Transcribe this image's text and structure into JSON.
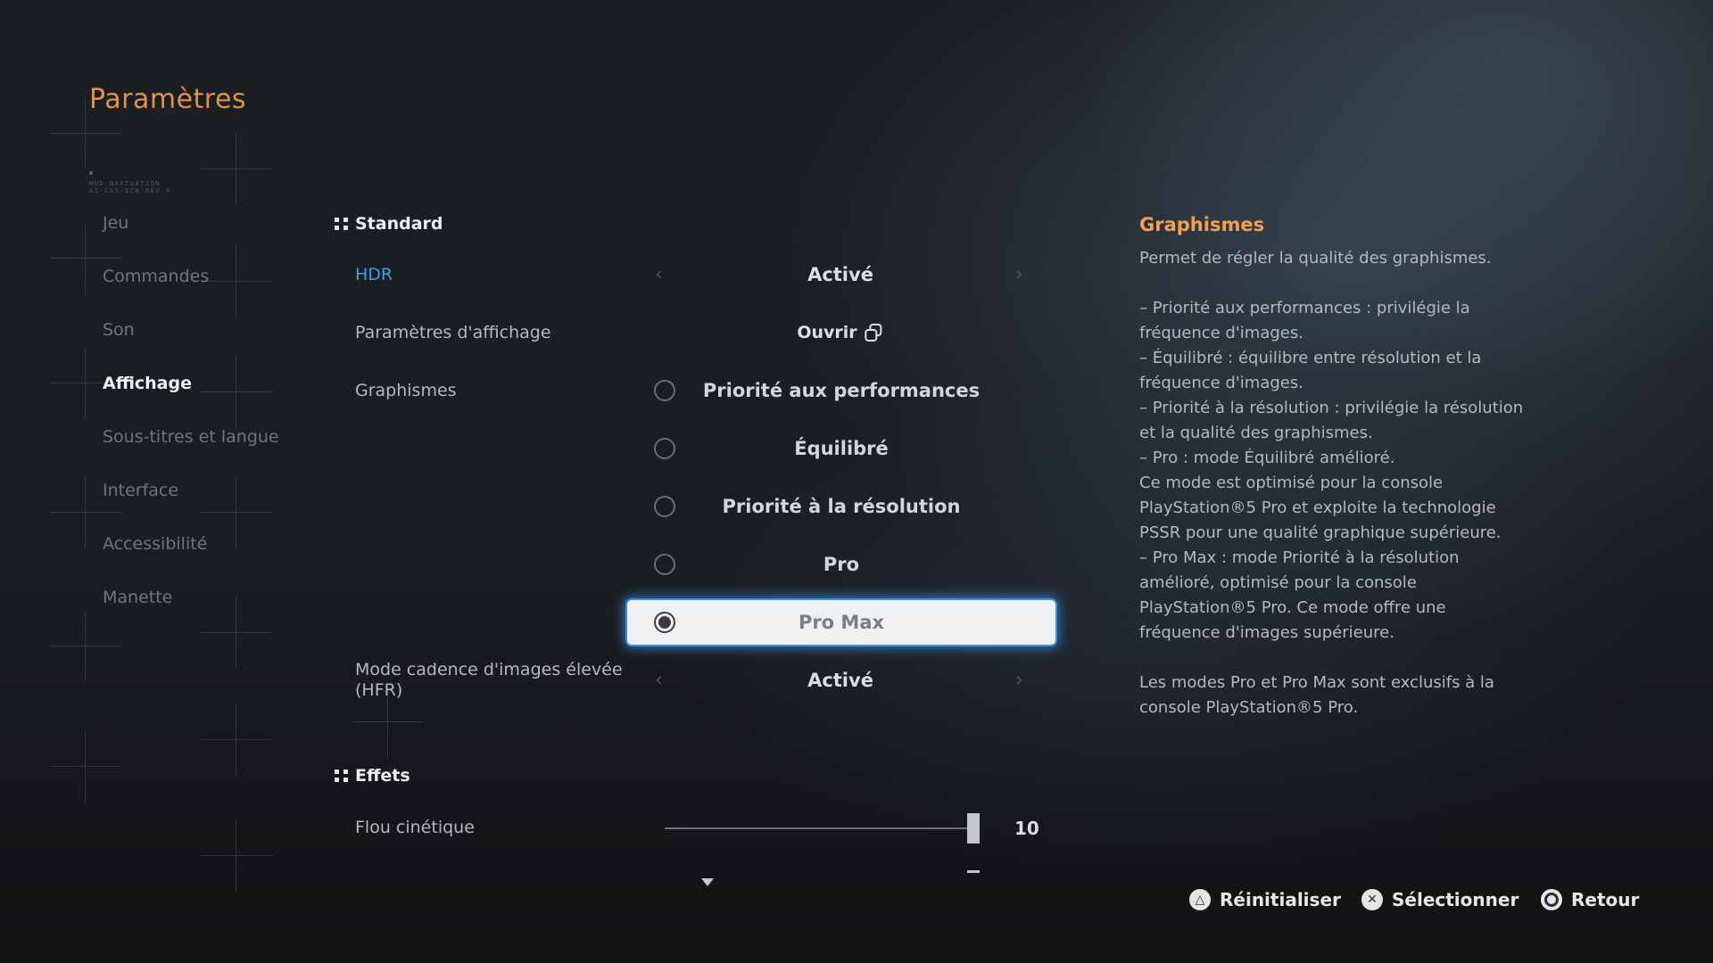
{
  "header": {
    "title": "Paramètres",
    "hud_lines": [
      "HUD NAVIGATION",
      "AI-CSS-ICN REV 0"
    ]
  },
  "sidebar": {
    "items": [
      {
        "label": "Jeu",
        "active": false
      },
      {
        "label": "Commandes",
        "active": false
      },
      {
        "label": "Son",
        "active": false
      },
      {
        "label": "Affichage",
        "active": true
      },
      {
        "label": "Sous-titres et langue",
        "active": false
      },
      {
        "label": "Interface",
        "active": false
      },
      {
        "label": "Accessibilité",
        "active": false
      },
      {
        "label": "Manette",
        "active": false
      }
    ]
  },
  "main": {
    "sections": [
      {
        "title": "Standard",
        "rows": [
          {
            "label": "HDR",
            "value": "Activé",
            "type": "selector",
            "focused": true
          },
          {
            "label": "Paramètres d'affichage",
            "value": "Ouvrir",
            "type": "link",
            "icon": "external-open-icon"
          },
          {
            "label": "Graphismes",
            "type": "radio-group",
            "options": [
              {
                "label": "Priorité aux performances",
                "selected": false
              },
              {
                "label": "Équilibré",
                "selected": false
              },
              {
                "label": "Priorité à la résolution",
                "selected": false
              },
              {
                "label": "Pro",
                "selected": false
              },
              {
                "label": "Pro Max",
                "selected": true
              }
            ]
          },
          {
            "label": "Mode cadence d'images élevée (HFR)",
            "label_line1": "Mode cadence d'images élevée",
            "label_line2": "(HFR)",
            "value": "Activé",
            "type": "selector"
          }
        ]
      },
      {
        "title": "Effets",
        "rows": [
          {
            "label": "Flou cinétique",
            "type": "slider",
            "value": "10",
            "min": 0,
            "max": 10,
            "fraction": 1.0
          }
        ]
      }
    ],
    "arrow_left": "‹",
    "arrow_right": "›"
  },
  "info_panel": {
    "title": "Graphismes",
    "body": "Permet de régler la qualité des graphismes.\n\n– Priorité aux performances : privilégie la fréquence d'images.\n– Équilibré : équilibre entre résolution et la fréquence d'images.\n– Priorité à la résolution : privilégie la résolution et la qualité des graphismes.\n– Pro : mode Équilibré amélioré.\nCe mode est optimisé pour la console PlayStation®5 Pro et exploite la technologie PSSR pour une qualité graphique supérieure.\n– Pro Max : mode Priorité à la résolution amélioré, optimisé pour la console PlayStation®5 Pro. Ce mode offre une fréquence d'images supérieure.\n\nLes modes Pro et Pro Max sont exclusifs à la console PlayStation®5 Pro."
  },
  "footer": {
    "buttons": [
      {
        "label": "Réinitialiser",
        "icon": "triangle-button-icon",
        "glyph": "△"
      },
      {
        "label": "Sélectionner",
        "icon": "cross-button-icon",
        "glyph": "✕"
      },
      {
        "label": "Retour",
        "icon": "circle-button-icon",
        "glyph": ""
      }
    ]
  },
  "colors": {
    "accent_orange": "#e0924a",
    "focus_blue": "#3d9ee0",
    "selection_glow": "#3c8fe0"
  }
}
